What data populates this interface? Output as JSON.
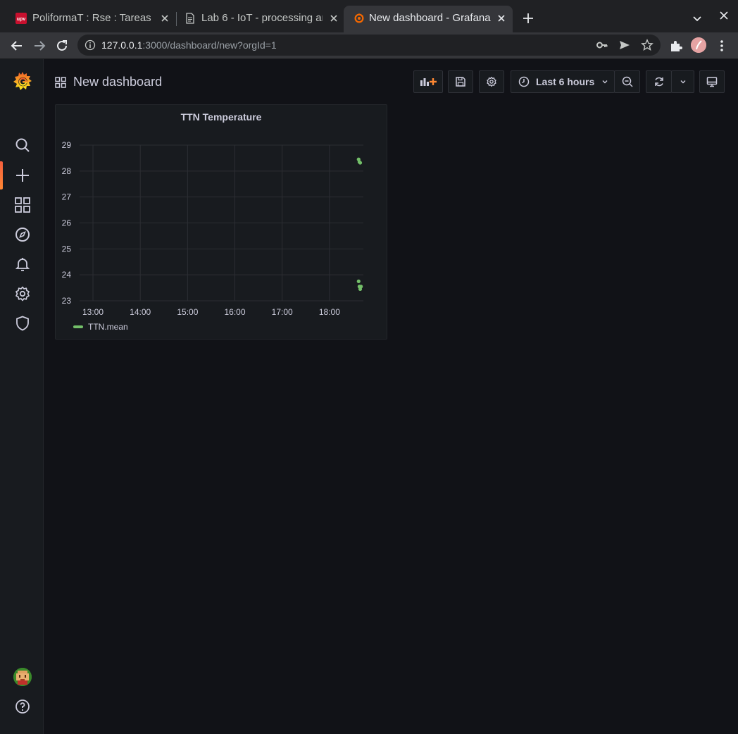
{
  "browser": {
    "tabs": [
      {
        "title": "PoliformaT : Rse : Tareas",
        "favicon": "upv-favicon"
      },
      {
        "title": "Lab 6 - IoT - processing and",
        "favicon": "document-icon"
      },
      {
        "title": "New dashboard - Grafana",
        "favicon": "grafana-favicon",
        "active": true
      }
    ],
    "url_host": "127.0.0.1",
    "url_rest": ":3000/dashboard/new?orgId=1"
  },
  "dashboard": {
    "title": "New dashboard",
    "time_range": "Last 6 hours"
  },
  "panel": {
    "title": "TTN Temperature"
  },
  "chart_data": {
    "type": "scatter",
    "title": "TTN Temperature",
    "x_ticks": [
      "13:00",
      "14:00",
      "15:00",
      "16:00",
      "17:00",
      "18:00"
    ],
    "y_ticks": [
      23,
      24,
      25,
      26,
      27,
      28,
      29
    ],
    "ylim": [
      23,
      29
    ],
    "xlim": [
      "12:43",
      "18:43"
    ],
    "grid": true,
    "legend_placement": "bottom-left",
    "series": [
      {
        "name": "TTN.mean",
        "color": "#73bf69",
        "points": [
          {
            "x": "18:37",
            "y": 28.45
          },
          {
            "x": "18:38",
            "y": 28.35
          },
          {
            "x": "18:39",
            "y": 28.32
          },
          {
            "x": "18:37",
            "y": 23.75
          },
          {
            "x": "18:38",
            "y": 23.55
          },
          {
            "x": "18:39",
            "y": 23.45
          },
          {
            "x": "18:40",
            "y": 23.55
          }
        ]
      }
    ]
  },
  "colors": {
    "background": "#111217",
    "panel": "#181b1f",
    "accent": "#ff8833",
    "series": "#73bf69"
  }
}
